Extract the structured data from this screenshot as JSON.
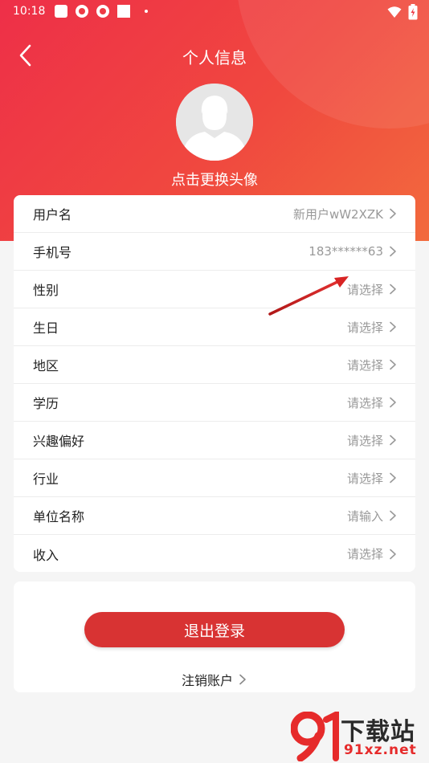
{
  "status": {
    "time": "10:18",
    "icons": [
      "notification-square-icon",
      "app-icon",
      "app-icon",
      "notification-square-icon",
      "dot-icon"
    ],
    "right_icons": [
      "wifi-icon",
      "battery-icon"
    ]
  },
  "nav": {
    "title": "个人信息",
    "back_icon": "chevron-left-icon"
  },
  "avatar": {
    "hint": "点击更换头像"
  },
  "profile": {
    "rows": [
      {
        "label": "用户名",
        "value": "新用户wW2XZK"
      },
      {
        "label": "手机号",
        "value": "183******63"
      },
      {
        "label": "性别",
        "value": "请选择"
      },
      {
        "label": "生日",
        "value": "请选择"
      },
      {
        "label": "地区",
        "value": "请选择"
      },
      {
        "label": "学历",
        "value": "请选择"
      },
      {
        "label": "兴趣偏好",
        "value": "请选择"
      },
      {
        "label": "行业",
        "value": "请选择"
      },
      {
        "label": "单位名称",
        "value": "请输入"
      },
      {
        "label": "收入",
        "value": "请选择"
      }
    ]
  },
  "actions": {
    "logout": "退出登录",
    "cancel_account": "注销账户"
  },
  "watermark": {
    "text": "下载站",
    "url": "91xz.net"
  },
  "colors": {
    "header_start": "#ee2f48",
    "header_end": "#f26a3d",
    "button": "#d83333",
    "value_text": "#999999"
  }
}
